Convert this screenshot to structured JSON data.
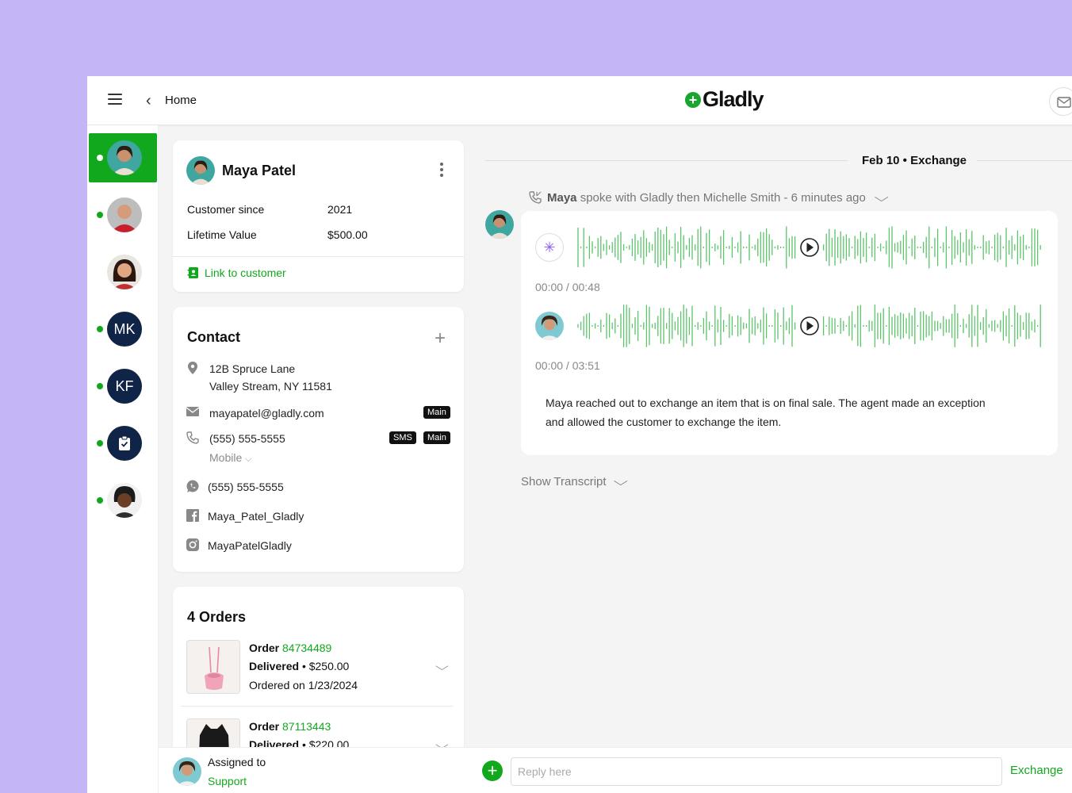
{
  "header": {
    "home_label": "Home",
    "brand_name": "Gladly",
    "brand_mark": "+"
  },
  "rail": {
    "items": [
      {
        "kind": "photo",
        "active": true
      },
      {
        "kind": "photo"
      },
      {
        "kind": "photo"
      },
      {
        "kind": "initials",
        "text": "MK"
      },
      {
        "kind": "initials",
        "text": "KF"
      },
      {
        "kind": "icon",
        "icon": "clipboard-icon"
      },
      {
        "kind": "photo"
      }
    ]
  },
  "customer": {
    "name": "Maya Patel",
    "since_label": "Customer since",
    "since_value": "2021",
    "ltv_label": "Lifetime Value",
    "ltv_value": "$500.00",
    "link_label": "Link to customer"
  },
  "contact": {
    "title": "Contact",
    "address_line1": "12B Spruce Lane",
    "address_line2": "Valley Stream, NY 11581",
    "email": "mayapatel@gladly.com",
    "email_tag": "Main",
    "phone": "(555) 555-5555",
    "phone_tag_sms": "SMS",
    "phone_tag_main": "Main",
    "phone_type": "Mobile",
    "whatsapp": "(555) 555-5555",
    "facebook": "Maya_Patel_Gladly",
    "instagram": "MayaPatelGladly"
  },
  "orders": {
    "title": "4 Orders",
    "items": [
      {
        "label": "Order",
        "number": "84734489",
        "status": "Delivered",
        "sep": "•",
        "amount": "$250.00",
        "date": "Ordered on 1/23/2024"
      },
      {
        "label": "Order",
        "number": "87113443",
        "status": "Delivered",
        "sep": "•",
        "amount": "$220.00"
      }
    ]
  },
  "conversation": {
    "date": "Feb 10 •",
    "topic": "Exchange",
    "caller": "Maya",
    "call_meta": "spoke with Gladly then Michelle Smith - 6 minutes ago",
    "clip1_time": "00:00 / 00:48",
    "clip2_time": "00:00 / 03:51",
    "summary": "Maya reached out to exchange an item that is on final sale. The agent made an exception and allowed the customer to exchange the item.",
    "transcript_label": "Show Transcript"
  },
  "footer": {
    "assigned_label": "Assigned to",
    "assigned_team": "Support",
    "reply_placeholder": "Reply here",
    "channel_label": "Exchange"
  },
  "colors": {
    "brand_green": "#12a81e",
    "background": "#c4b5f7",
    "rail_initials": "#102447",
    "ai_accent": "#8b5cf6"
  }
}
